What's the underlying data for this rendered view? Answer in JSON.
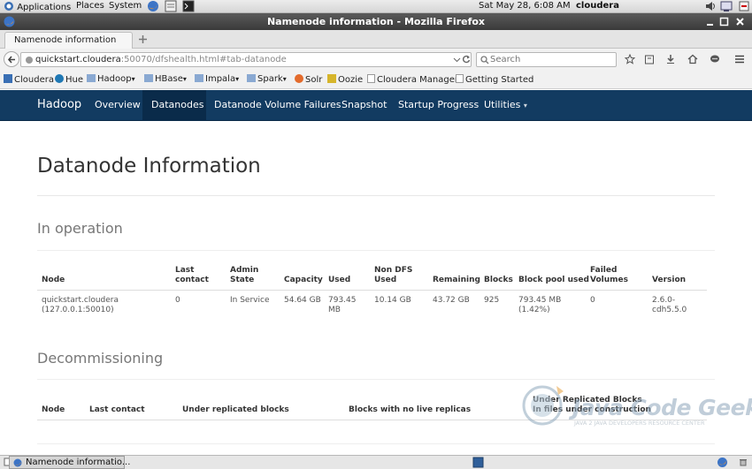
{
  "desktop": {
    "menus": [
      "Applications",
      "Places",
      "System"
    ],
    "datetime": "Sat May 28,  6:08 AM",
    "user": "cloudera"
  },
  "window": {
    "title": "Namenode information - Mozilla Firefox"
  },
  "browser": {
    "tab_label": "Namenode information",
    "url_host": "quickstart.cloudera",
    "url_rest": ":50070/dfshealth.html#tab-datanode",
    "search_placeholder": "Search"
  },
  "bookmarks": [
    "Cloudera",
    "Hue",
    "Hadoop",
    "HBase",
    "Impala",
    "Spark",
    "Solr",
    "Oozie",
    "Cloudera Manager",
    "Getting Started"
  ],
  "nav": {
    "brand": "Hadoop",
    "items": [
      "Overview",
      "Datanodes",
      "Datanode Volume Failures",
      "Snapshot",
      "Startup Progress",
      "Utilities"
    ],
    "active": "Datanodes"
  },
  "page": {
    "title": "Datanode Information",
    "in_operation": {
      "heading": "In operation",
      "headers": [
        "Node",
        "Last\ncontact",
        "Admin\nState",
        "Capacity",
        "Used",
        "Non DFS\nUsed",
        "Remaining",
        "Blocks",
        "Block pool used",
        "Failed\nVolumes",
        "Version"
      ],
      "rows": [
        [
          "quickstart.cloudera\n(127.0.0.1:50010)",
          "0",
          "In Service",
          "54.64 GB",
          "793.45\nMB",
          "10.14 GB",
          "43.72 GB",
          "925",
          "793.45 MB\n(1.42%)",
          "0",
          "2.6.0-\ncdh5.5.0"
        ]
      ]
    },
    "decommissioning": {
      "heading": "Decommissioning",
      "headers": [
        "Node",
        "Last contact",
        "Under replicated blocks",
        "Blocks with no live replicas",
        "Under Replicated Blocks\nIn files under construction"
      ]
    }
  },
  "watermark": {
    "name": "Java Code Geeks",
    "tagline": "JAVA 2 JAVA DEVELOPERS RESOURCE CENTER"
  },
  "taskbar": {
    "window_label": "Namenode informatio..."
  }
}
